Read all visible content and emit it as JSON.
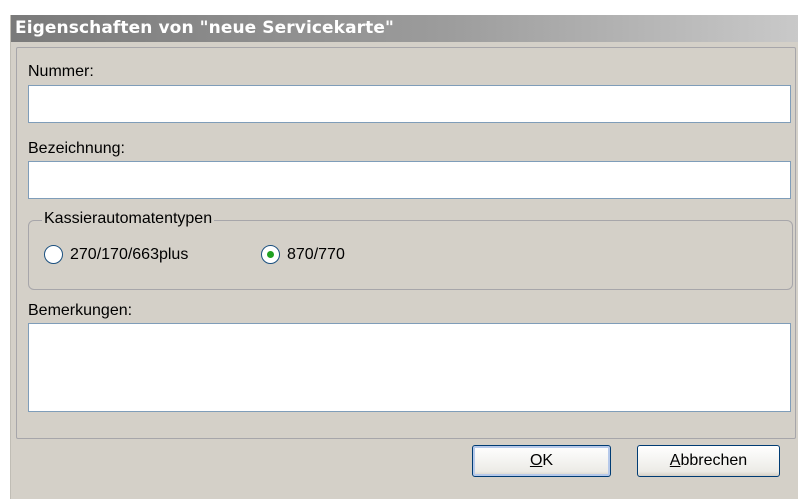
{
  "dialog": {
    "title": "Eigenschaften von \"neue Servicekarte\""
  },
  "form": {
    "nummer_label": "Nummer:",
    "nummer_value": "",
    "bezeichnung_label": "Bezeichnung:",
    "bezeichnung_value": "",
    "group_label": "Kassierautomatentypen",
    "radio_options": [
      {
        "label": "270/170/663plus",
        "selected": false
      },
      {
        "label": "870/770",
        "selected": true
      }
    ],
    "bemerkungen_label": "Bemerkungen:",
    "bemerkungen_value": ""
  },
  "buttons": {
    "ok_mnemonic": "O",
    "ok_rest": "K",
    "cancel_mnemonic": "A",
    "cancel_rest": "bbrechen"
  },
  "colors": {
    "radio_selected": "#21a121",
    "input_border": "#7f9db9",
    "dialog_background": "#d4d0c8"
  }
}
